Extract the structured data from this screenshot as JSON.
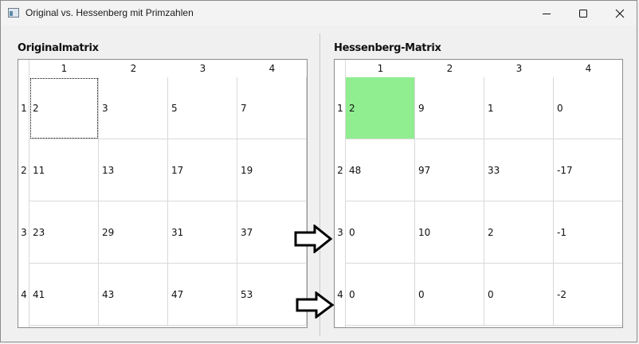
{
  "window": {
    "title": "Original vs. Hessenberg mit Primzahlen"
  },
  "left": {
    "title": "Originalmatrix",
    "col_headers": [
      "1",
      "2",
      "3",
      "4"
    ],
    "row_headers": [
      "1",
      "2",
      "3",
      "4"
    ],
    "rows": [
      [
        "2",
        "3",
        "5",
        "7"
      ],
      [
        "11",
        "13",
        "17",
        "19"
      ],
      [
        "23",
        "29",
        "31",
        "37"
      ],
      [
        "41",
        "43",
        "47",
        "53"
      ]
    ]
  },
  "right": {
    "title": "Hessenberg-Matrix",
    "col_headers": [
      "1",
      "2",
      "3",
      "4"
    ],
    "row_headers": [
      "1",
      "2",
      "3",
      "4"
    ],
    "rows": [
      [
        "2",
        "9",
        "1",
        "0"
      ],
      [
        "48",
        "97",
        "33",
        "-17"
      ],
      [
        "0",
        "10",
        "2",
        "-1"
      ],
      [
        "0",
        "0",
        "0",
        "-2"
      ]
    ],
    "highlight_color": "#90ee90"
  }
}
